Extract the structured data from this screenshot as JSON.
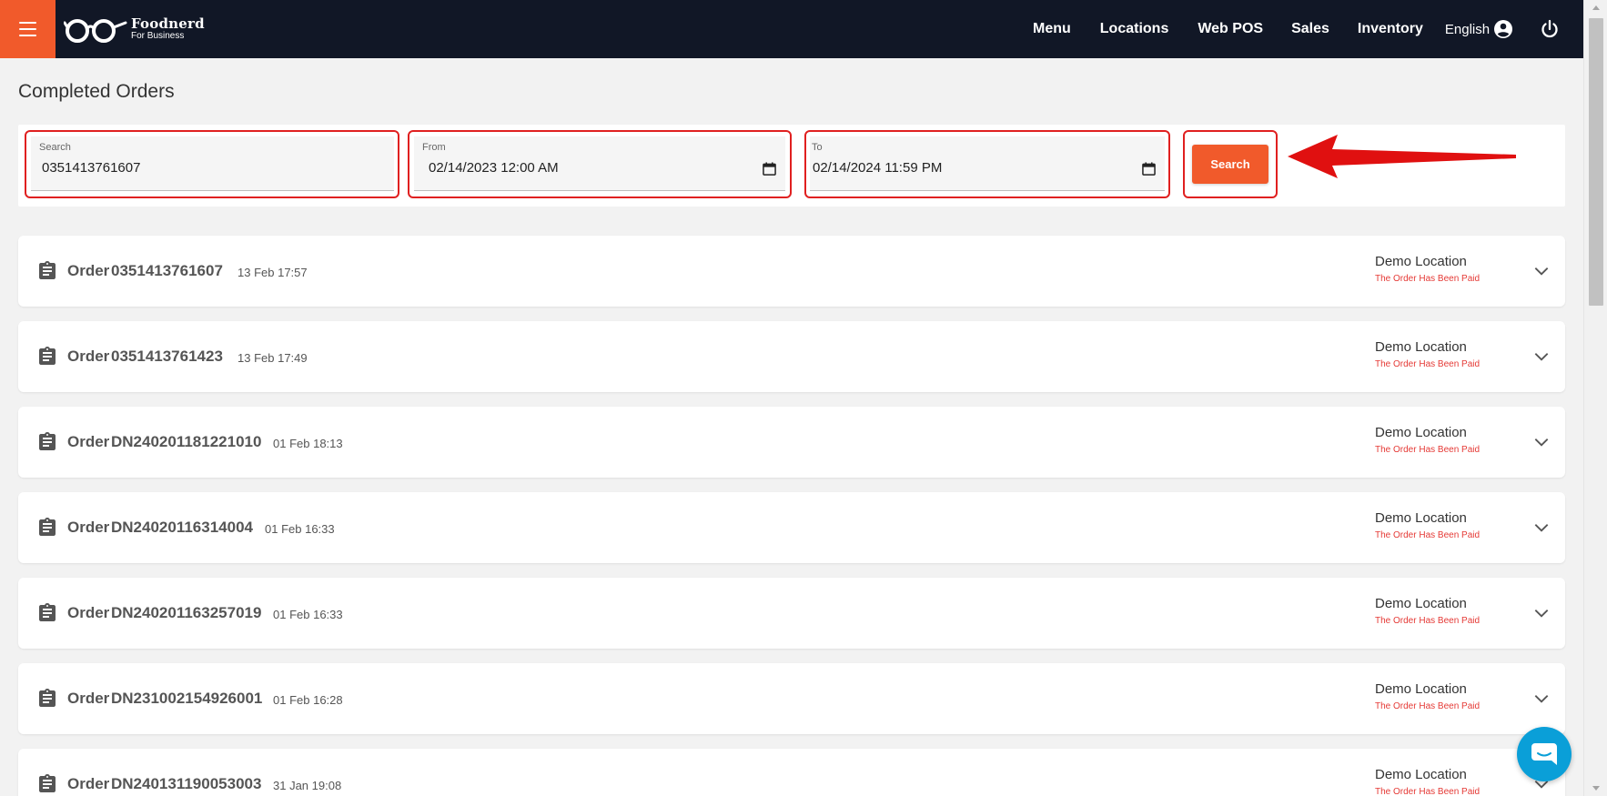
{
  "brand": {
    "name": "Foodnerd",
    "tagline": "For Business"
  },
  "nav": {
    "links": [
      "Menu",
      "Locations",
      "Web POS",
      "Sales",
      "Inventory"
    ],
    "language": "English"
  },
  "page": {
    "title": "Completed Orders"
  },
  "filters": {
    "search": {
      "label": "Search",
      "value": "0351413761607"
    },
    "from": {
      "label": "From",
      "value": "02/14/2023 12:00 AM"
    },
    "to": {
      "label": "To",
      "value": "02/14/2024 11:59 PM"
    },
    "search_button": "Search"
  },
  "orders": [
    {
      "label": "Order",
      "id": "0351413761607",
      "time": "13 Feb 17:57",
      "location": "Demo Location",
      "status": "The Order Has Been Paid"
    },
    {
      "label": "Order",
      "id": "0351413761423",
      "time": "13 Feb 17:49",
      "location": "Demo Location",
      "status": "The Order Has Been Paid"
    },
    {
      "label": "Order",
      "id": "DN240201181221010",
      "time": "01 Feb 18:13",
      "location": "Demo Location",
      "status": "The Order Has Been Paid"
    },
    {
      "label": "Order",
      "id": "DN24020116314004",
      "time": "01 Feb 16:33",
      "location": "Demo Location",
      "status": "The Order Has Been Paid"
    },
    {
      "label": "Order",
      "id": "DN240201163257019",
      "time": "01 Feb 16:33",
      "location": "Demo Location",
      "status": "The Order Has Been Paid"
    },
    {
      "label": "Order",
      "id": "DN231002154926001",
      "time": "01 Feb 16:28",
      "location": "Demo Location",
      "status": "The Order Has Been Paid"
    },
    {
      "label": "Order",
      "id": "DN240131190053003",
      "time": "31 Jan 19:08",
      "location": "Demo Location",
      "status": "The Order Has Been Paid"
    }
  ],
  "colors": {
    "navbar": "#111726",
    "accent": "#f15a2b",
    "status": "#e53935",
    "highlight": "#e02020",
    "chat": "#0a9fd8"
  },
  "icons": {
    "menu": "hamburger-icon",
    "order": "clipboard-icon",
    "expand": "chevron-down-icon",
    "account": "account-circle-icon",
    "logout": "power-icon",
    "date": "calendar-icon",
    "chat": "chat-icon"
  }
}
